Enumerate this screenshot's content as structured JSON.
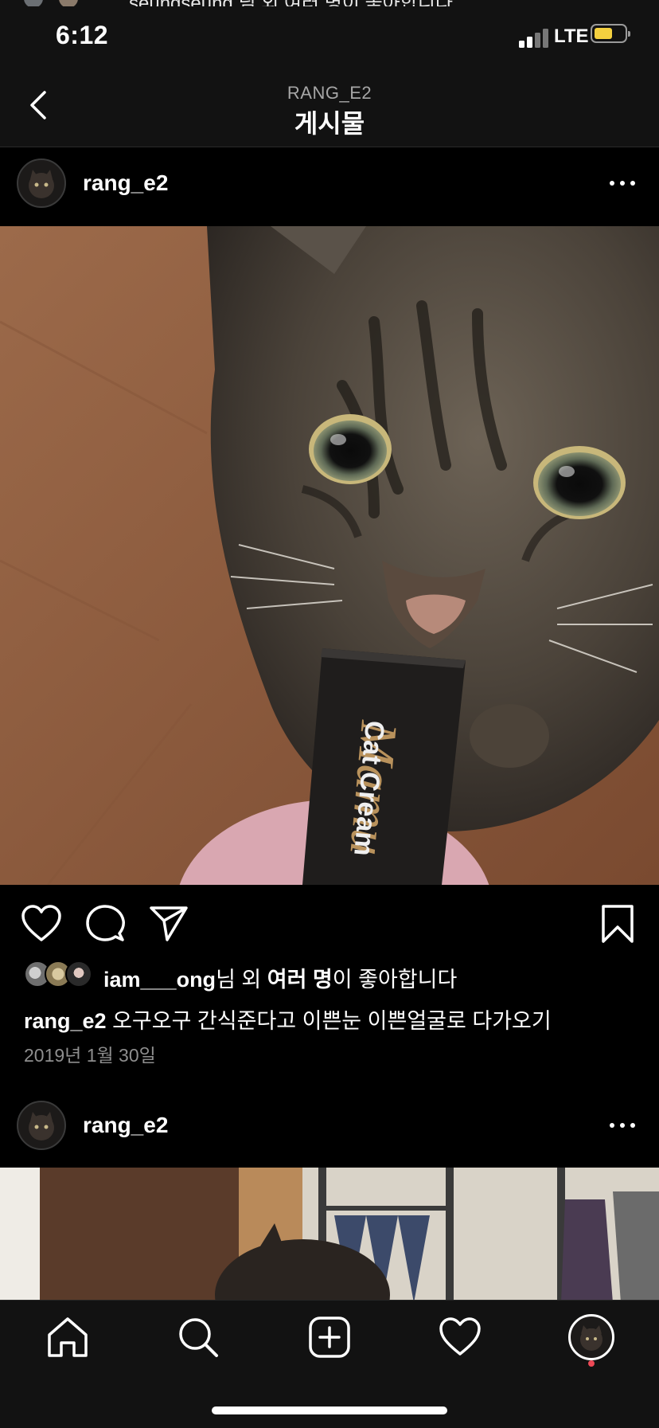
{
  "peek": {
    "text": "seungseung 님 외 여러 명이 좋아합니다"
  },
  "status": {
    "time": "6:12",
    "network": "LTE"
  },
  "header": {
    "subtitle": "RANG_E2",
    "title": "게시물"
  },
  "post": {
    "username": "rang_e2",
    "photo_alt": "Cat Cream",
    "likes": {
      "user": "iam___ong",
      "suffix_1": "님 외 ",
      "bold_2": "여러 명",
      "suffix_2": "이 좋아합니다"
    },
    "caption_user": "rang_e2",
    "caption_text": " 오구오구 간식준다고 이쁜눈 이쁜얼굴로 다가오기",
    "date": "2019년 1월 30일"
  },
  "post2": {
    "username": "rang_e2"
  },
  "icons": {
    "back": "chevron-left-icon",
    "more": "more-horizontal-icon",
    "like": "heart-icon",
    "comment": "comment-icon",
    "share": "send-icon",
    "save": "bookmark-icon",
    "home": "home-icon",
    "search": "search-icon",
    "add": "plus-square-icon",
    "activity": "heart-icon",
    "profile": "avatar"
  },
  "colors": {
    "background": "#000000",
    "header": "#121212",
    "muted": "#8e8e8e",
    "notification": "#ed4956",
    "battery": "#f4d03f"
  }
}
